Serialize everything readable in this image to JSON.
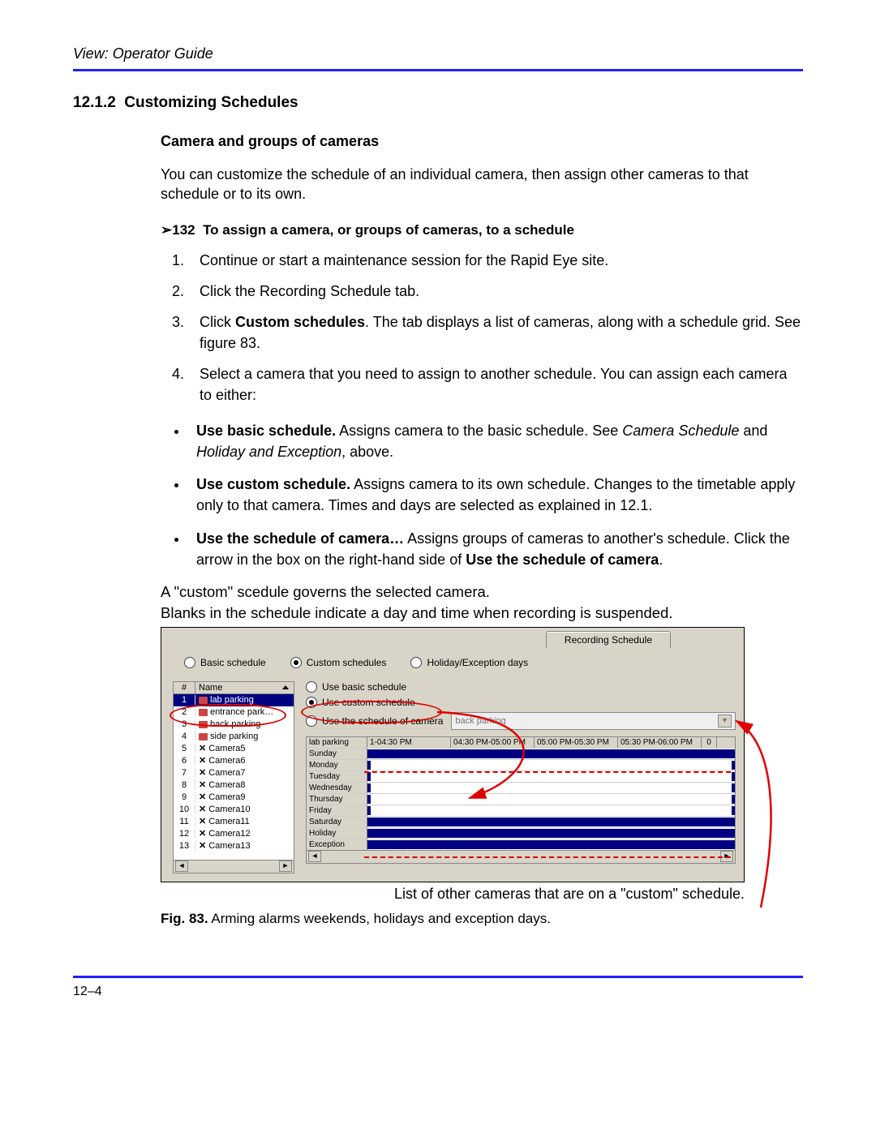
{
  "header": "View: Operator Guide",
  "section_number": "12.1.2",
  "section_title": "Customizing Schedules",
  "subhead": "Camera and groups of cameras",
  "intro": "You can customize the schedule of an individual camera, then assign other cameras to that schedule or to its own.",
  "proc_marker": "➢132",
  "proc_title": "To assign a camera, or groups of cameras, to a schedule",
  "steps": {
    "s1": "Continue or start a maintenance session for the Rapid Eye site.",
    "s2": "Click the Recording Schedule tab.",
    "s3a": "Click ",
    "s3b": "Custom schedules",
    "s3c": ". The tab displays a list of cameras, along with a schedule grid. See figure 83.",
    "s4": "Select a camera that you need to assign to another schedule. You can assign each camera to either:"
  },
  "bullets": {
    "b1a": "Use basic schedule.",
    "b1b": " Assigns camera to the basic schedule. See ",
    "b1c": "Camera Schedule",
    "b1d": " and ",
    "b1e": "Holiday and Exception",
    "b1f": ", above.",
    "b2a": "Use custom schedule.",
    "b2b": " Assigns camera to its own schedule. Changes to the timetable apply only to that camera. Times and days are selected as explained in 12.1.",
    "b3a": "Use the schedule of camera…",
    "b3b": " Assigns groups of cameras to another's schedule. Click the arrow in the box on the right-hand side of ",
    "b3c": "Use the schedule of camera",
    "b3d": "."
  },
  "annot_top1": "A \"custom\" scedule governs the selected camera.",
  "annot_top2": "Blanks in the schedule indicate a day and time when recording is suspended.",
  "screenshot": {
    "tab": "Recording Schedule",
    "top_radios": {
      "basic": "Basic schedule",
      "custom": "Custom schedules",
      "holiday": "Holiday/Exception days"
    },
    "col_hash": "#",
    "col_name": "Name",
    "cameras": [
      {
        "n": "1",
        "name": "lab parking",
        "type": "cam",
        "sel": true
      },
      {
        "n": "2",
        "name": "entrance park…",
        "type": "cam",
        "sel": false
      },
      {
        "n": "3",
        "name": "back parking",
        "type": "cam",
        "sel": false
      },
      {
        "n": "4",
        "name": "side parking",
        "type": "cam",
        "sel": false
      },
      {
        "n": "5",
        "name": "Camera5",
        "type": "x",
        "sel": false
      },
      {
        "n": "6",
        "name": "Camera6",
        "type": "x",
        "sel": false
      },
      {
        "n": "7",
        "name": "Camera7",
        "type": "x",
        "sel": false
      },
      {
        "n": "8",
        "name": "Camera8",
        "type": "x",
        "sel": false
      },
      {
        "n": "9",
        "name": "Camera9",
        "type": "x",
        "sel": false
      },
      {
        "n": "10",
        "name": "Camera10",
        "type": "x",
        "sel": false
      },
      {
        "n": "11",
        "name": "Camera11",
        "type": "x",
        "sel": false
      },
      {
        "n": "12",
        "name": "Camera12",
        "type": "x",
        "sel": false
      },
      {
        "n": "13",
        "name": "Camera13",
        "type": "x",
        "sel": false
      }
    ],
    "right_radios": {
      "use_basic": "Use basic schedule",
      "use_custom": "Use custom schedule",
      "use_other": "Use the schedule of camera"
    },
    "combo_value": "back parking",
    "grid_corner": "lab parking",
    "time_cols": [
      "1-04:30 PM",
      "04:30 PM-05:00 PM",
      "05:00 PM-05:30 PM",
      "05:30 PM-06:00 PM"
    ],
    "time_extra": "0",
    "days": [
      "Sunday",
      "Monday",
      "Tuesday",
      "Wednesday",
      "Thursday",
      "Friday",
      "Saturday",
      "Holiday",
      "Exception"
    ],
    "full_days": [
      "Sunday",
      "Saturday",
      "Holiday",
      "Exception"
    ]
  },
  "annot_bottom": "List of other cameras that are on a \"custom\" schedule.",
  "fig_label": "Fig. 83.",
  "fig_text": " Arming alarms weekends, holidays and exception days.",
  "page_number": "12–4"
}
